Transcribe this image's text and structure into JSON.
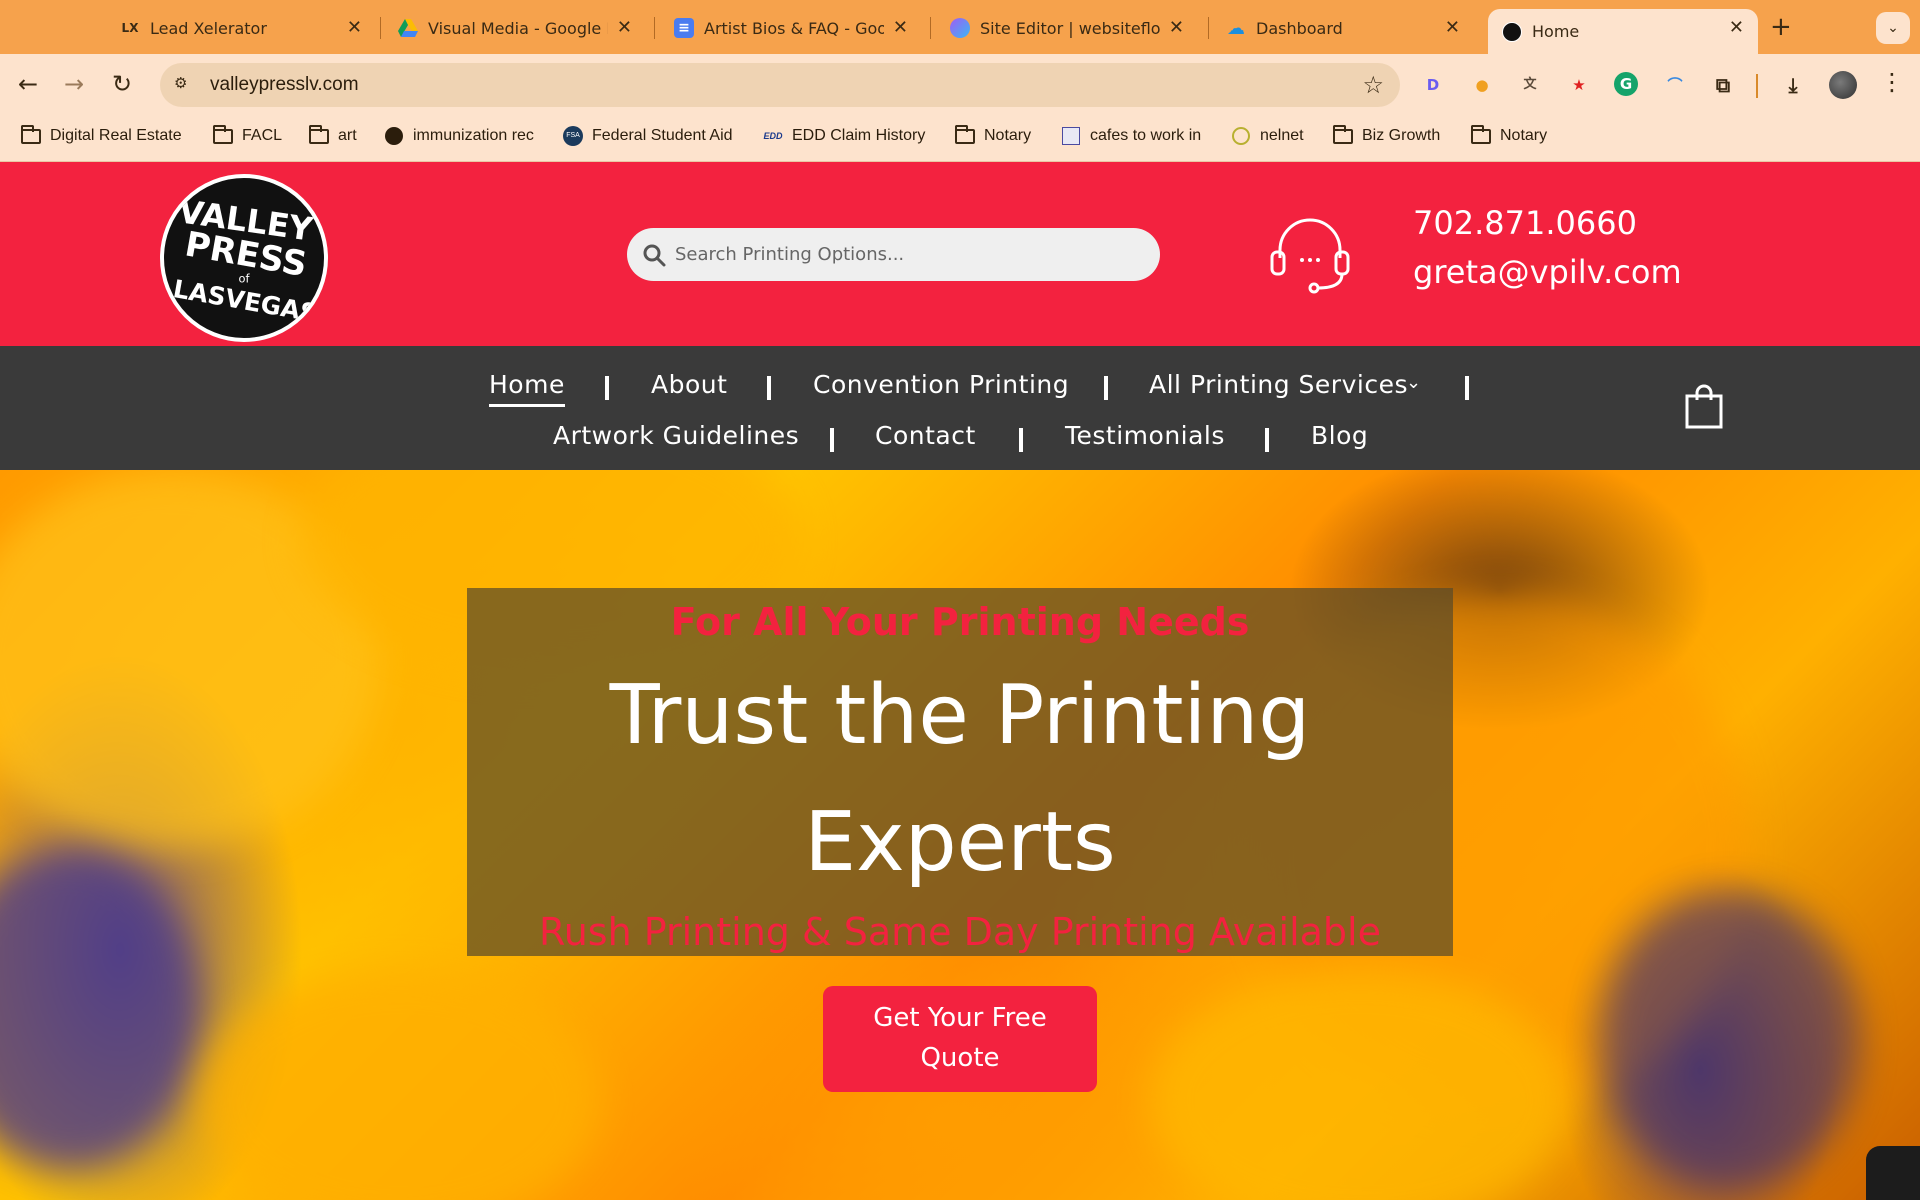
{
  "browser": {
    "tabs": [
      {
        "title": "Lead Xelerator",
        "favicon": "lead-xelerator-icon",
        "active": false
      },
      {
        "title": "Visual Media - Google D",
        "favicon": "google-drive-icon",
        "active": false
      },
      {
        "title": "Artist Bios & FAQ - Goo",
        "favicon": "google-docs-icon",
        "active": false
      },
      {
        "title": "Site Editor | websiteflo",
        "favicon": "site-editor-icon",
        "active": false
      },
      {
        "title": "Dashboard",
        "favicon": "dashboard-cloud-icon",
        "active": false
      },
      {
        "title": "Home",
        "favicon": "valley-press-icon",
        "active": true
      }
    ],
    "url": "valleypresslv.com",
    "bookmarks": [
      {
        "label": "Digital Real Estate",
        "icon": "folder-icon"
      },
      {
        "label": "FACL",
        "icon": "folder-icon"
      },
      {
        "label": "art",
        "icon": "folder-icon"
      },
      {
        "label": "immunization rec",
        "icon": "globe-icon"
      },
      {
        "label": "Federal Student Aid",
        "icon": "fsa-icon"
      },
      {
        "label": "EDD Claim History",
        "icon": "edd-icon"
      },
      {
        "label": "Notary",
        "icon": "folder-icon"
      },
      {
        "label": "cafes to work in",
        "icon": "cafe-icon"
      },
      {
        "label": "nelnet",
        "icon": "nelnet-icon"
      },
      {
        "label": "Biz Growth",
        "icon": "folder-icon"
      },
      {
        "label": "Notary",
        "icon": "folder-icon"
      }
    ],
    "colors": {
      "tabbar": "#f6a24c",
      "toolbar": "#fde3cd"
    }
  },
  "header": {
    "search_placeholder": "Search Printing Options...",
    "phone": "702.871.0660",
    "email": "greta@vpilv.com",
    "brand_color": "#f3223f"
  },
  "nav": {
    "row1": [
      "Home",
      "About",
      "Convention Printing",
      "All Printing Services"
    ],
    "row2": [
      "Artwork Guidelines",
      "Contact",
      "Testimonials",
      "Blog"
    ],
    "current": "Home",
    "dropdown_indicator": "chevron-down-icon"
  },
  "hero": {
    "kicker": "For All Your Printing Needs",
    "title_line1": "Trust the Printing",
    "title_line2": "Experts",
    "subtitle": "Rush Printing & Same Day Printing Available",
    "cta_line1": "Get Your Free",
    "cta_line2": "Quote"
  }
}
